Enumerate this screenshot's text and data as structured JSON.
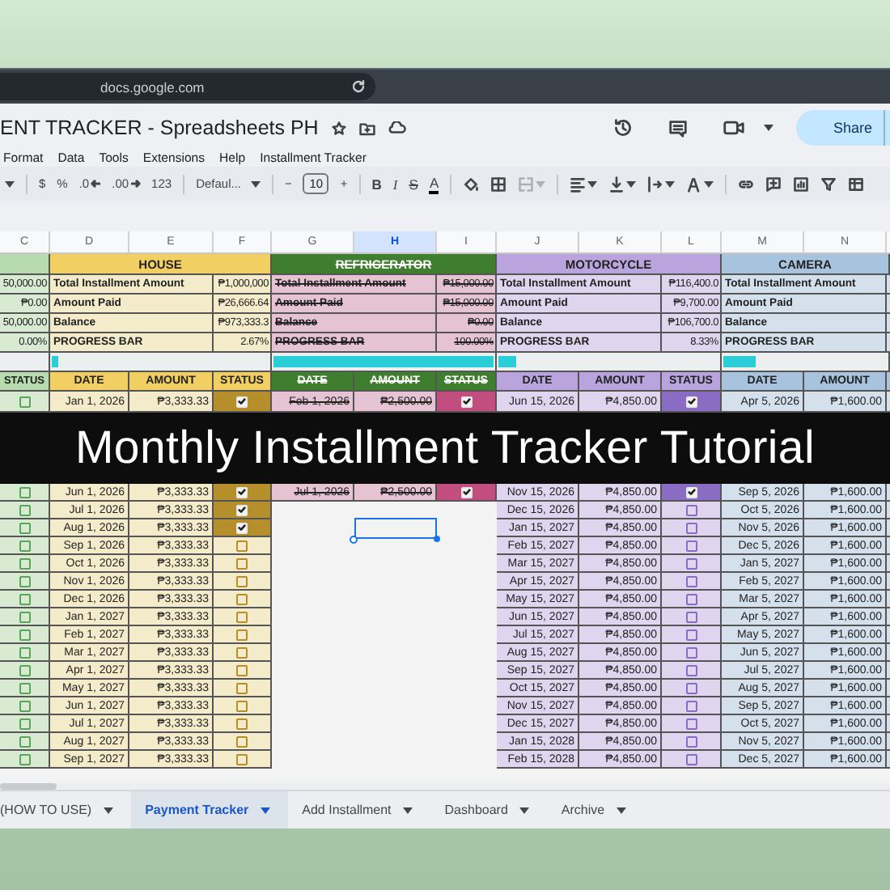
{
  "browser": {
    "address": "docs.google.com"
  },
  "document": {
    "title": "ENT TRACKER - Spreadsheets PH",
    "share_label": "Share"
  },
  "menu": [
    "Format",
    "Data",
    "Tools",
    "Extensions",
    "Help",
    "Installment Tracker"
  ],
  "toolbar": {
    "format_buttons": [
      "$",
      "%",
      ".0",
      ".00",
      "123"
    ],
    "font": "Defaul...",
    "size_buttons": [
      "−",
      "+"
    ],
    "font_size": "10",
    "style_buttons": [
      "B",
      "I",
      "S",
      "A"
    ]
  },
  "column_letters": [
    {
      "label": "C",
      "selected": false
    },
    {
      "label": "D",
      "selected": false
    },
    {
      "label": "E",
      "selected": false
    },
    {
      "label": "F",
      "selected": false
    },
    {
      "label": "G",
      "selected": false
    },
    {
      "label": "H",
      "selected": true
    },
    {
      "label": "I",
      "selected": false
    },
    {
      "label": "J",
      "selected": false
    },
    {
      "label": "K",
      "selected": false
    },
    {
      "label": "L",
      "selected": false
    },
    {
      "label": "M",
      "selected": false
    },
    {
      "label": "N",
      "selected": false
    }
  ],
  "sheet": {
    "leading_column": {
      "color": "#d8ead2",
      "header": {
        "text": "STATUS",
        "color": "#b7dbae"
      },
      "checkbox": {
        "color": "#5aa55a"
      },
      "summary_values": [
        "50,000.00",
        "₱0.00",
        "50,000.00",
        "0.00%"
      ],
      "top_rows": [
        {
          "checked": false
        }
      ],
      "rows": [
        {
          "checked": false
        },
        {
          "checked": false
        },
        {
          "checked": false
        },
        {
          "checked": false
        },
        {
          "checked": false
        },
        {
          "checked": false
        },
        {
          "checked": false
        },
        {
          "checked": false
        },
        {
          "checked": false
        },
        {
          "checked": false
        },
        {
          "checked": false
        },
        {
          "checked": false
        },
        {
          "checked": false
        },
        {
          "checked": false
        },
        {
          "checked": false
        },
        {
          "checked": false
        }
      ]
    },
    "sections": [
      {
        "title": {
          "text": "HOUSE",
          "color": "#f1cf63"
        },
        "color": "#f4ebca",
        "checkbox": {
          "color": "#b58f2c"
        },
        "completed": false,
        "summary": [
          {
            "label": "Total Installment Amount",
            "value": "₱1,000,000"
          },
          {
            "label": "Amount Paid",
            "value": "₱26,666.64"
          },
          {
            "label": "Balance",
            "value": "₱973,333.3"
          },
          {
            "label": "PROGRESS BAR",
            "value": "2.67%"
          }
        ],
        "progress": {
          "level": 0.0267
        },
        "headers": [
          "DATE",
          "AMOUNT",
          "STATUS"
        ],
        "top_rows": [
          {
            "date": "Jan 1, 2026",
            "amount": "₱3,333.33",
            "checked": true
          }
        ],
        "rows": [
          {
            "date": "Jun 1, 2026",
            "amount": "₱3,333.33",
            "checked": true
          },
          {
            "date": "Jul 1, 2026",
            "amount": "₱3,333.33",
            "checked": true
          },
          {
            "date": "Aug 1, 2026",
            "amount": "₱3,333.33",
            "checked": true
          },
          {
            "date": "Sep 1, 2026",
            "amount": "₱3,333.33",
            "checked": false
          },
          {
            "date": "Oct 1, 2026",
            "amount": "₱3,333.33",
            "checked": false
          },
          {
            "date": "Nov 1, 2026",
            "amount": "₱3,333.33",
            "checked": false
          },
          {
            "date": "Dec 1, 2026",
            "amount": "₱3,333.33",
            "checked": false
          },
          {
            "date": "Jan 1, 2027",
            "amount": "₱3,333.33",
            "checked": false
          },
          {
            "date": "Feb 1, 2027",
            "amount": "₱3,333.33",
            "checked": false
          },
          {
            "date": "Mar 1, 2027",
            "amount": "₱3,333.33",
            "checked": false
          },
          {
            "date": "Apr 1, 2027",
            "amount": "₱3,333.33",
            "checked": false
          },
          {
            "date": "May 1, 2027",
            "amount": "₱3,333.33",
            "checked": false
          },
          {
            "date": "Jun 1, 2027",
            "amount": "₱3,333.33",
            "checked": false
          },
          {
            "date": "Jul 1, 2027",
            "amount": "₱3,333.33",
            "checked": false
          },
          {
            "date": "Aug 1, 2027",
            "amount": "₱3,333.33",
            "checked": false
          },
          {
            "date": "Sep 1, 2027",
            "amount": "₱3,333.33",
            "checked": false
          }
        ]
      },
      {
        "title": {
          "text": "REFRIGERATOR",
          "color": "#3f7e2e"
        },
        "color": "#e5c3d2",
        "checkbox": {
          "color": "#c24e80"
        },
        "completed": true,
        "summary": [
          {
            "label": "Total Installment Amount",
            "value": "₱15,000.00"
          },
          {
            "label": "Amount Paid",
            "value": "₱15,000.00"
          },
          {
            "label": "Balance",
            "value": "₱0.00"
          },
          {
            "label": "PROGRESS BAR",
            "value": "100.00%"
          }
        ],
        "progress": {
          "level": 1
        },
        "headers": [
          "DATE",
          "AMOUNT",
          "STATUS"
        ],
        "top_rows": [
          {
            "date": "Feb 1, 2026",
            "amount": "₱2,500.00",
            "checked": true
          }
        ],
        "rows": [
          {
            "date": "Jul 1, 2026",
            "amount": "₱2,500.00",
            "checked": true
          }
        ]
      },
      {
        "title": {
          "text": "MOTORCYCLE",
          "color": "#b9a4dd"
        },
        "color": "#dfd5ee",
        "checkbox": {
          "color": "#8a6cc2"
        },
        "completed": false,
        "summary": [
          {
            "label": "Total Installment Amount",
            "value": "₱116,400.0"
          },
          {
            "label": "Amount Paid",
            "value": "₱9,700.00"
          },
          {
            "label": "Balance",
            "value": "₱106,700.0"
          },
          {
            "label": "PROGRESS BAR",
            "value": "8.33%"
          }
        ],
        "progress": {
          "level": 0.0833
        },
        "headers": [
          "DATE",
          "AMOUNT",
          "STATUS"
        ],
        "top_rows": [
          {
            "date": "Jun 15, 2026",
            "amount": "₱4,850.00",
            "checked": true
          }
        ],
        "rows": [
          {
            "date": "Nov 15, 2026",
            "amount": "₱4,850.00",
            "checked": true
          },
          {
            "date": "Dec 15, 2026",
            "amount": "₱4,850.00",
            "checked": false
          },
          {
            "date": "Jan 15, 2027",
            "amount": "₱4,850.00",
            "checked": false
          },
          {
            "date": "Feb 15, 2027",
            "amount": "₱4,850.00",
            "checked": false
          },
          {
            "date": "Mar 15, 2027",
            "amount": "₱4,850.00",
            "checked": false
          },
          {
            "date": "Apr 15, 2027",
            "amount": "₱4,850.00",
            "checked": false
          },
          {
            "date": "May 15, 2027",
            "amount": "₱4,850.00",
            "checked": false
          },
          {
            "date": "Jun 15, 2027",
            "amount": "₱4,850.00",
            "checked": false
          },
          {
            "date": "Jul 15, 2027",
            "amount": "₱4,850.00",
            "checked": false
          },
          {
            "date": "Aug 15, 2027",
            "amount": "₱4,850.00",
            "checked": false
          },
          {
            "date": "Sep 15, 2027",
            "amount": "₱4,850.00",
            "checked": false
          },
          {
            "date": "Oct 15, 2027",
            "amount": "₱4,850.00",
            "checked": false
          },
          {
            "date": "Nov 15, 2027",
            "amount": "₱4,850.00",
            "checked": false
          },
          {
            "date": "Dec 15, 2027",
            "amount": "₱4,850.00",
            "checked": false
          },
          {
            "date": "Jan 15, 2028",
            "amount": "₱4,850.00",
            "checked": false
          },
          {
            "date": "Feb 15, 2028",
            "amount": "₱4,850.00",
            "checked": false
          }
        ]
      },
      {
        "title": {
          "text": "CAMERA",
          "color": "#a8c3de"
        },
        "color": "#d4e1ed",
        "completed": false,
        "summary": [
          {
            "label": "Total Installment Amount"
          },
          {
            "label": "Amount Paid"
          },
          {
            "label": "Balance"
          },
          {
            "label": "PROGRESS BAR"
          }
        ],
        "progress": {
          "level": 0.2
        },
        "headers": [
          "DATE",
          "AMOUNT"
        ],
        "top_rows": [
          {
            "date": "Apr 5, 2026",
            "amount": "₱1,600.00"
          }
        ],
        "rows": [
          {
            "date": "Sep 5, 2026",
            "amount": "₱1,600.00"
          },
          {
            "date": "Oct 5, 2026",
            "amount": "₱1,600.00"
          },
          {
            "date": "Nov 5, 2026",
            "amount": "₱1,600.00"
          },
          {
            "date": "Dec 5, 2026",
            "amount": "₱1,600.00"
          },
          {
            "date": "Jan 5, 2027",
            "amount": "₱1,600.00"
          },
          {
            "date": "Feb 5, 2027",
            "amount": "₱1,600.00"
          },
          {
            "date": "Mar 5, 2027",
            "amount": "₱1,600.00"
          },
          {
            "date": "Apr 5, 2027",
            "amount": "₱1,600.00"
          },
          {
            "date": "May 5, 2027",
            "amount": "₱1,600.00"
          },
          {
            "date": "Jun 5, 2027",
            "amount": "₱1,600.00"
          },
          {
            "date": "Jul 5, 2027",
            "amount": "₱1,600.00"
          },
          {
            "date": "Aug 5, 2027",
            "amount": "₱1,600.00"
          },
          {
            "date": "Sep 5, 2027",
            "amount": "₱1,600.00"
          },
          {
            "date": "Oct 5, 2027",
            "amount": "₱1,600.00"
          },
          {
            "date": "Nov 5, 2027",
            "amount": "₱1,600.00"
          },
          {
            "date": "Dec 5, 2027",
            "amount": "₱1,600.00"
          }
        ]
      }
    ]
  },
  "banner": {
    "text": "Monthly Installment Tracker Tutorial"
  },
  "sheet_tabs": [
    {
      "label": "(HOW TO USE)",
      "selected": false
    },
    {
      "label": "Payment Tracker",
      "selected": true
    },
    {
      "label": "Add Installment",
      "selected": false
    },
    {
      "label": "Dashboard",
      "selected": false
    },
    {
      "label": "Archive",
      "selected": false
    }
  ]
}
